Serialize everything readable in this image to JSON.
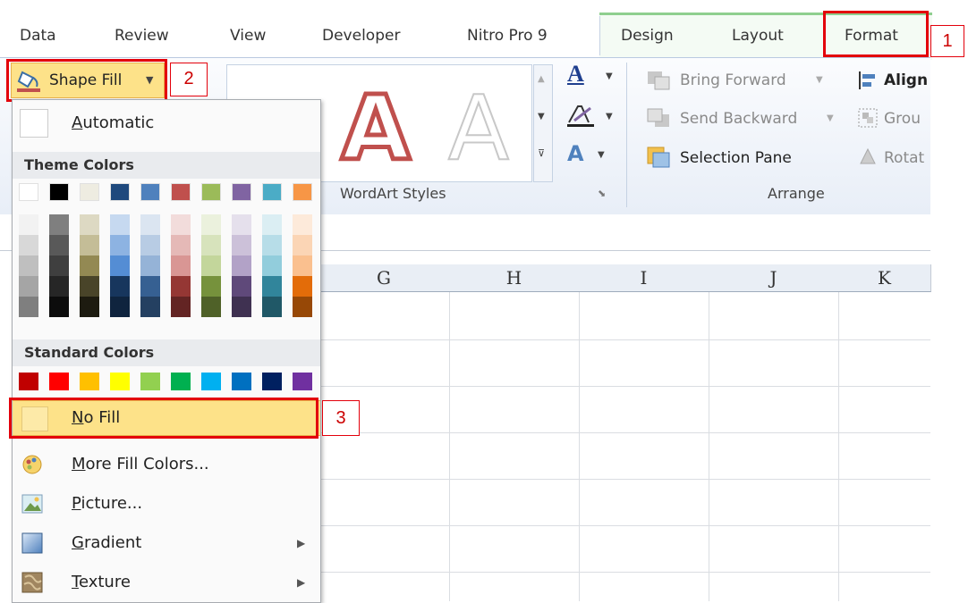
{
  "tabs": [
    {
      "label": "Data"
    },
    {
      "label": "Review"
    },
    {
      "label": "View"
    },
    {
      "label": "Developer"
    },
    {
      "label": "Nitro Pro 9"
    },
    {
      "label": "Design"
    },
    {
      "label": "Layout"
    },
    {
      "label": "Format"
    }
  ],
  "ribbon": {
    "shape_fill_label": "Shape Fill",
    "wordart_group_label": "WordArt Styles",
    "arrange_group_label": "Arrange",
    "bring_forward": "Bring Forward",
    "send_backward": "Send Backward",
    "selection_pane": "Selection Pane",
    "align": "Align",
    "group": "Grou",
    "rotate": "Rotat"
  },
  "columns": [
    "G",
    "H",
    "I",
    "J",
    "K"
  ],
  "menu": {
    "automatic": "Automatic",
    "theme_colors_header": "Theme Colors",
    "standard_colors_header": "Standard Colors",
    "no_fill": "No Fill",
    "more_fill_colors": "More Fill Colors...",
    "picture": "Picture...",
    "gradient": "Gradient",
    "texture": "Texture"
  },
  "theme_colors": [
    "#ffffff",
    "#000000",
    "#eeece1",
    "#1f497d",
    "#4f81bd",
    "#c0504d",
    "#9bbb59",
    "#8064a2",
    "#4bacc6",
    "#f79646"
  ],
  "theme_shades": [
    [
      "#f2f2f2",
      "#d8d8d8",
      "#bfbfbf",
      "#a5a5a5",
      "#7f7f7f"
    ],
    [
      "#7f7f7f",
      "#595959",
      "#3f3f3f",
      "#262626",
      "#0c0c0c"
    ],
    [
      "#ddd9c3",
      "#c4bd97",
      "#938953",
      "#494429",
      "#1d1b10"
    ],
    [
      "#c6d9f0",
      "#8db3e2",
      "#548dd4",
      "#17365d",
      "#0f243e"
    ],
    [
      "#dbe5f1",
      "#b8cce4",
      "#95b3d7",
      "#366092",
      "#244061"
    ],
    [
      "#f2dcdb",
      "#e5b9b7",
      "#d99694",
      "#953734",
      "#632423"
    ],
    [
      "#ebf1dd",
      "#d7e3bc",
      "#c3d69b",
      "#76923c",
      "#4f6128"
    ],
    [
      "#e5e0ec",
      "#ccc1d9",
      "#b2a2c7",
      "#5f497a",
      "#3f3151"
    ],
    [
      "#dbeef3",
      "#b7dde8",
      "#92cddc",
      "#31859b",
      "#205867"
    ],
    [
      "#fdeada",
      "#fbd5b5",
      "#fac08f",
      "#e36c09",
      "#974806"
    ]
  ],
  "standard_colors": [
    "#c00000",
    "#ff0000",
    "#ffc000",
    "#ffff00",
    "#92d050",
    "#00b050",
    "#00b0f0",
    "#0070c0",
    "#002060",
    "#7030a0"
  ],
  "callouts": {
    "one": "1",
    "two": "2",
    "three": "3"
  },
  "colors": {
    "highlight": "#fde289",
    "callout_red": "#e3000b"
  }
}
